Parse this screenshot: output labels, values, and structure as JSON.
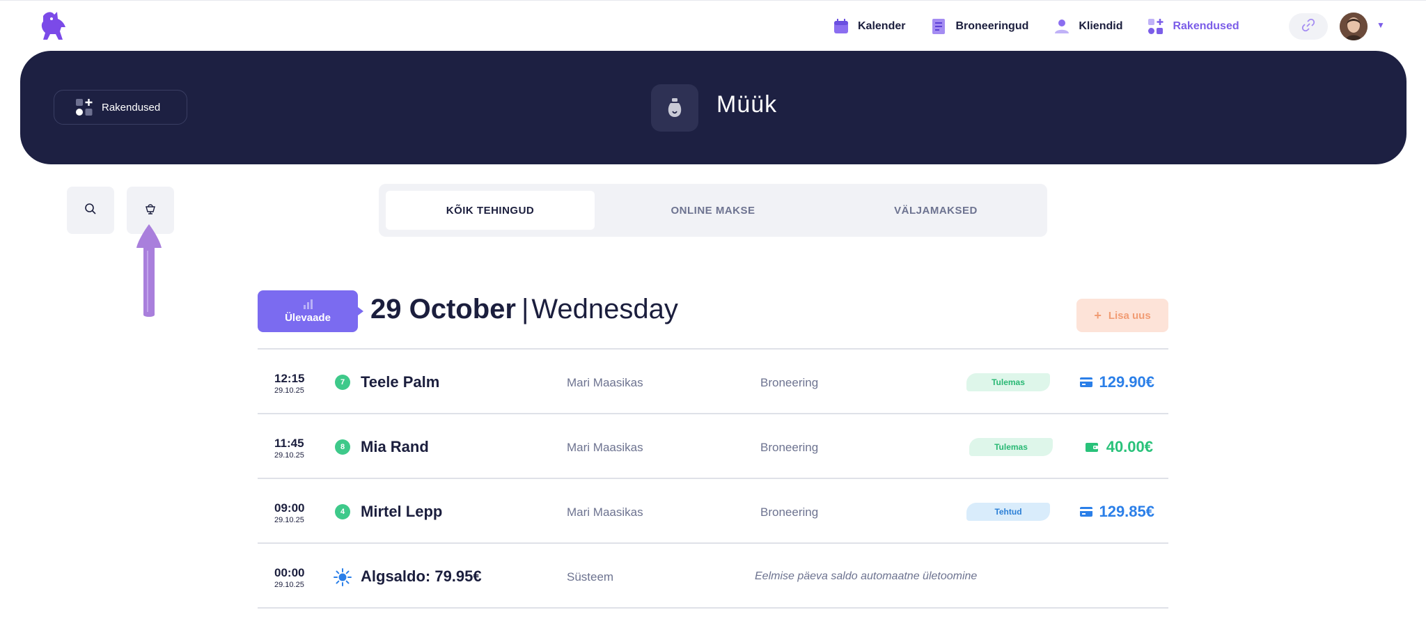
{
  "nav": {
    "items": [
      {
        "label": "Kalender",
        "icon": "calendar-icon"
      },
      {
        "label": "Broneeringud",
        "icon": "bookings-icon"
      },
      {
        "label": "Kliendid",
        "icon": "clients-icon"
      },
      {
        "label": "Rakendused",
        "icon": "apps-icon",
        "active": true
      }
    ],
    "accent": "#7b5de8"
  },
  "hero": {
    "back_label": "Rakendused",
    "title": "Müük",
    "background": "#1d2042"
  },
  "tabs": [
    {
      "label": "KÕIK TEHINGUD",
      "active": true
    },
    {
      "label": "ONLINE MAKSE",
      "active": false
    },
    {
      "label": "VÄLJAMAKSED",
      "active": false
    }
  ],
  "day": {
    "overview_label": "Ülevaade",
    "date": "29 October",
    "separator": "|",
    "weekday": "Wednesday",
    "add_label": "Lisa uus"
  },
  "transactions": [
    {
      "time": "12:15",
      "date": "29.10.25",
      "badge": "7",
      "name": "Teele Palm",
      "staff": "Mari Maasikas",
      "type": "Broneering",
      "status": "Tulemas",
      "status_kind": "upcoming",
      "payment": "card-icon",
      "amount": "129.90€",
      "amount_color": "#2b7fe8"
    },
    {
      "time": "11:45",
      "date": "29.10.25",
      "badge": "8",
      "name": "Mia Rand",
      "staff": "Mari Maasikas",
      "type": "Broneering",
      "status": "Tulemas",
      "status_kind": "upcoming",
      "payment": "wallet-icon",
      "amount": "40.00€",
      "amount_color": "#29c27a"
    },
    {
      "time": "09:00",
      "date": "29.10.25",
      "badge": "4",
      "name": "Mirtel Lepp",
      "staff": "Mari Maasikas",
      "type": "Broneering",
      "status": "Tehtud",
      "status_kind": "done",
      "payment": "card-icon",
      "amount": "129.85€",
      "amount_color": "#2b7fe8"
    }
  ],
  "opening": {
    "time": "00:00",
    "date": "29.10.25",
    "name": "Algsaldo: 79.95€",
    "staff": "Süsteem",
    "note": "Eelmise päeva saldo automaatne ületoomine"
  }
}
